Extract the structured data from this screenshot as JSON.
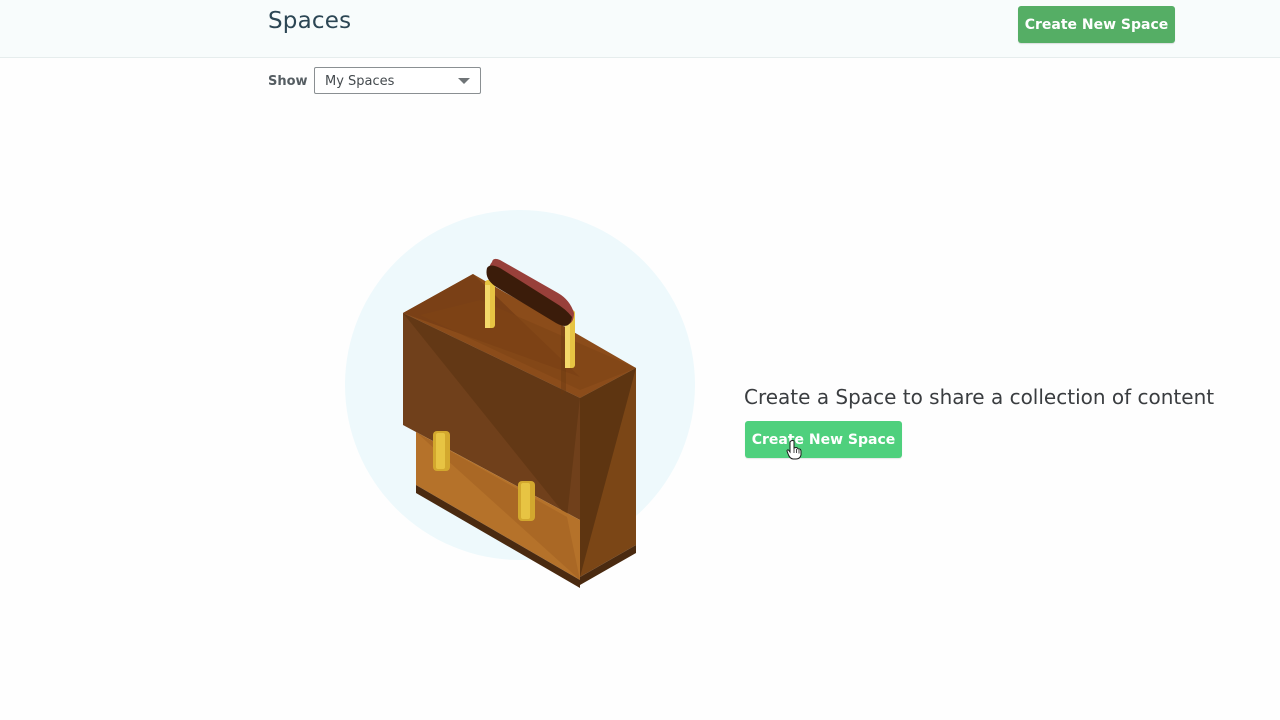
{
  "header": {
    "title": "Spaces",
    "create_button_label": "Create New Space"
  },
  "filter": {
    "label": "Show",
    "selected": "My Spaces"
  },
  "empty_state": {
    "message": "Create a Space to share a collection of content",
    "button_label": "Create New Space",
    "illustration_icon": "briefcase-icon"
  },
  "colors": {
    "header_button": "#55ae65",
    "main_button": "#4fd07d",
    "title_text": "#2c4654",
    "circle": "#eef9fc"
  }
}
